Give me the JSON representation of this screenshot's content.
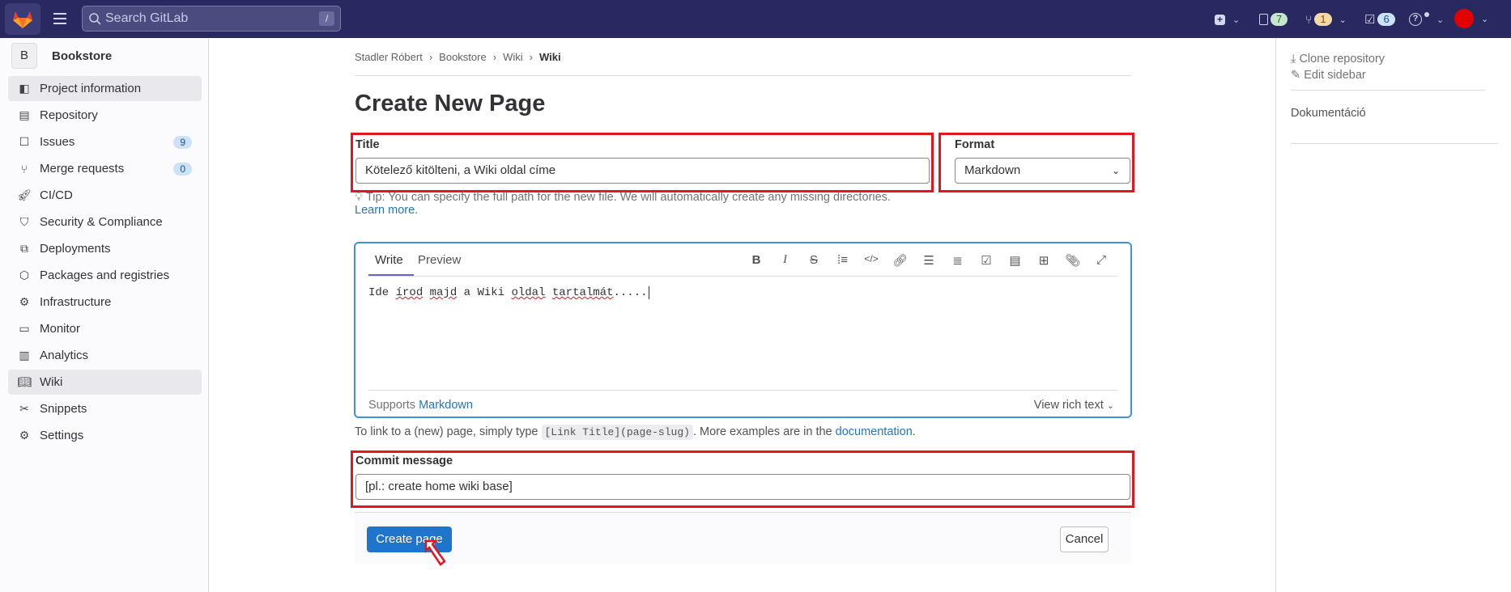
{
  "header": {
    "search_placeholder": "Search GitLab",
    "search_shortcut": "/",
    "mr_count": "7",
    "review_count": "1",
    "todo_count": "6",
    "colors": {
      "bg": "#292961",
      "mr_badge": "#c3e6cd",
      "review_badge": "#f5d9a8",
      "todo_badge": "#cbe2f9"
    }
  },
  "sidebar": {
    "project_initial": "B",
    "project_name": "Bookstore",
    "items": [
      {
        "label": "Project information",
        "icon": "info-icon"
      },
      {
        "label": "Repository",
        "icon": "doc-icon"
      },
      {
        "label": "Issues",
        "icon": "issues-icon",
        "badge": "9"
      },
      {
        "label": "Merge requests",
        "icon": "merge-request-icon",
        "badge": "0"
      },
      {
        "label": "CI/CD",
        "icon": "rocket-icon"
      },
      {
        "label": "Security & Compliance",
        "icon": "shield-icon"
      },
      {
        "label": "Deployments",
        "icon": "deployments-icon"
      },
      {
        "label": "Packages and registries",
        "icon": "package-icon"
      },
      {
        "label": "Infrastructure",
        "icon": "cloud-gear-icon"
      },
      {
        "label": "Monitor",
        "icon": "monitor-icon"
      },
      {
        "label": "Analytics",
        "icon": "chart-icon"
      },
      {
        "label": "Wiki",
        "icon": "book-icon"
      },
      {
        "label": "Snippets",
        "icon": "scissors-icon"
      },
      {
        "label": "Settings",
        "icon": "gear-icon"
      }
    ]
  },
  "breadcrumb": [
    "Stadler Róbert",
    "Bookstore",
    "Wiki",
    "Wiki"
  ],
  "page_title": "Create New Page",
  "form": {
    "title_label": "Title",
    "title_value": "Kötelező kitölteni, a Wiki oldal címe",
    "format_label": "Format",
    "format_value": "Markdown",
    "tip": "Tip: You can specify the full path for the new file. We will automatically create any missing directories.",
    "learn_more": "Learn more.",
    "editor": {
      "tab_write": "Write",
      "tab_preview": "Preview",
      "content_words": [
        "Ide ",
        "írod",
        " ",
        "majd",
        " a Wiki ",
        "oldal",
        " ",
        "tartalmát",
        ".....",
        ""
      ],
      "supports": "Supports ",
      "markdown_link": "Markdown",
      "view_rich": "View rich text"
    },
    "link_help_pre": "To link to a (new) page, simply type ",
    "link_help_code": "[Link Title](page-slug)",
    "link_help_mid": ". More examples are in the ",
    "link_help_link": "documentation",
    "link_help_end": ".",
    "commit_label": "Commit message",
    "commit_value": "[pl.: create home wiki base]",
    "create_button": "Create page",
    "cancel_button": "Cancel"
  },
  "right_sidebar": {
    "clone": "Clone repository",
    "edit": "Edit sidebar",
    "page": "Dokumentáció"
  },
  "annotation_color": "#e3151f"
}
